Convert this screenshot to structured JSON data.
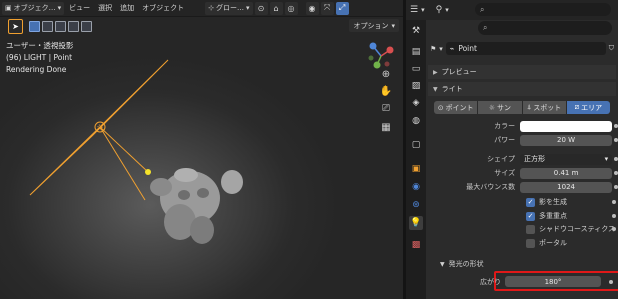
{
  "viewport": {
    "header": {
      "mode": "オブジェク…",
      "menus": [
        "ビュー",
        "選択",
        "追加",
        "オブジェクト"
      ],
      "transform_orientation": "グロー…"
    },
    "options_label": "オプション",
    "info": {
      "view_name": "ユーザー・透視投影",
      "object_line": "(96) LIGHT | Point",
      "status": "Rendering Done"
    }
  },
  "properties": {
    "object_name": "Point",
    "panels": {
      "preview": "プレビュー",
      "light": "ライト"
    },
    "light_types": [
      {
        "label": "ポイント",
        "active": false
      },
      {
        "label": "サン",
        "active": false
      },
      {
        "label": "スポット",
        "active": false
      },
      {
        "label": "エリア",
        "active": true
      }
    ],
    "color": {
      "label": "カラー",
      "value": "#ffffff"
    },
    "power": {
      "label": "パワー",
      "value": "20 W"
    },
    "shape": {
      "label": "シェイプ",
      "value": "正方形"
    },
    "size": {
      "label": "サイズ",
      "value": "0.41 m"
    },
    "max_bounces": {
      "label": "最大バウンス数",
      "value": "1024"
    },
    "checkboxes": [
      {
        "label": "影を生成",
        "checked": true
      },
      {
        "label": "多重重点",
        "checked": true
      },
      {
        "label": "シャドウコースティクス",
        "checked": false
      },
      {
        "label": "ポータル",
        "checked": false
      }
    ],
    "beam_shape": {
      "header": "発光の形状",
      "spread": {
        "label": "広がり",
        "value": "180°"
      }
    }
  },
  "colors": {
    "accent_blue": "#4772b3",
    "highlight_red": "#e01818",
    "light_orange": "#f0a030"
  }
}
